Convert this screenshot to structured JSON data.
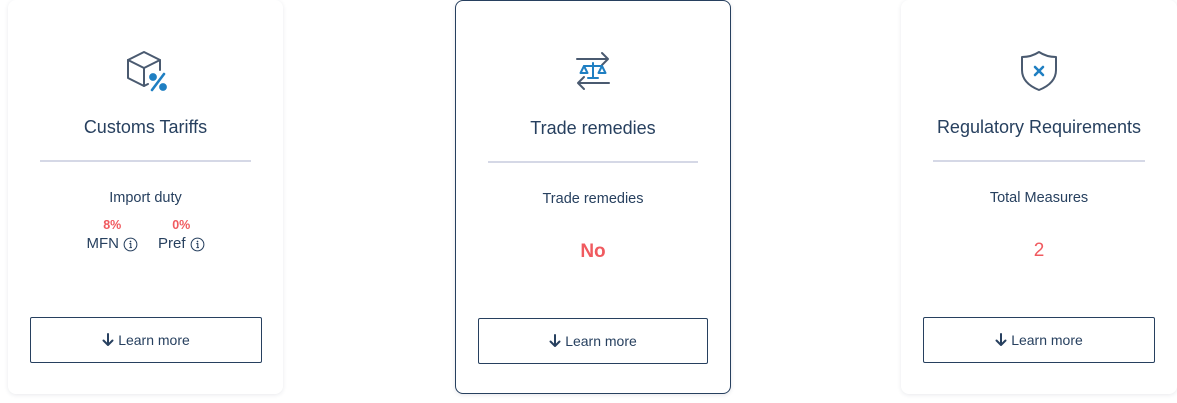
{
  "cards": [
    {
      "icon": "box-percent-icon",
      "title": "Customs Tariffs",
      "sub_label": "Import duty",
      "duties": [
        {
          "percent": "8%",
          "name": "MFN"
        },
        {
          "percent": "0%",
          "name": "Pref"
        }
      ],
      "button": "Learn more"
    },
    {
      "icon": "scale-exchange-icon",
      "title": "Trade remedies",
      "sub_label": "Trade remedies",
      "value": "No",
      "button": "Learn more"
    },
    {
      "icon": "shield-x-icon",
      "title": "Regulatory Requirements",
      "sub_label": "Total Measures",
      "value": "2",
      "button": "Learn more"
    }
  ],
  "colors": {
    "text": "#27405f",
    "icon_blue": "#1f7fc2",
    "icon_gray": "#4a5a70",
    "value_red": "#f05a5f",
    "divider": "#d5d8e6"
  }
}
